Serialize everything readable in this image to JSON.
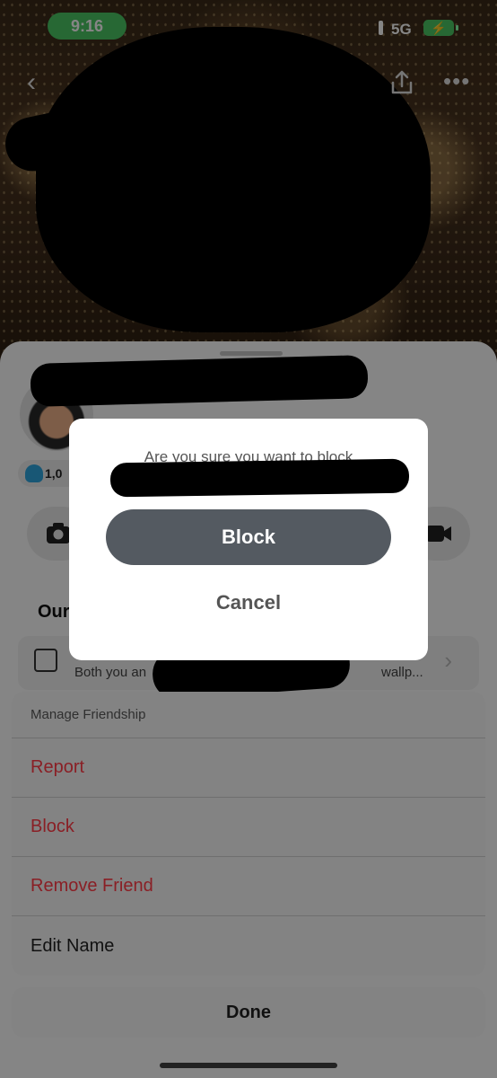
{
  "status_bar": {
    "time": "9:16",
    "network": "5G",
    "battery_icon": "battery-charging-icon"
  },
  "nav": {
    "back_icon": "chevron-left-icon",
    "share_icon": "share-icon",
    "more_icon": "more-horizontal-icon"
  },
  "profile": {
    "score_partial": "1,0",
    "section_title_partial": "Our",
    "wallpaper_text_start": "Both you an",
    "wallpaper_text_end": "wallp..."
  },
  "dialog": {
    "message": "Are you sure you want to block",
    "block_label": "Block",
    "cancel_label": "Cancel"
  },
  "action_sheet": {
    "header": "Manage Friendship",
    "items": [
      {
        "label": "Report",
        "style": "danger"
      },
      {
        "label": "Block",
        "style": "danger"
      },
      {
        "label": "Remove Friend",
        "style": "danger"
      },
      {
        "label": "Edit Name",
        "style": "normal"
      }
    ],
    "done_label": "Done"
  },
  "colors": {
    "time_pill": "#4cc764",
    "danger_text": "#8a1f25",
    "block_button": "#545a61"
  }
}
